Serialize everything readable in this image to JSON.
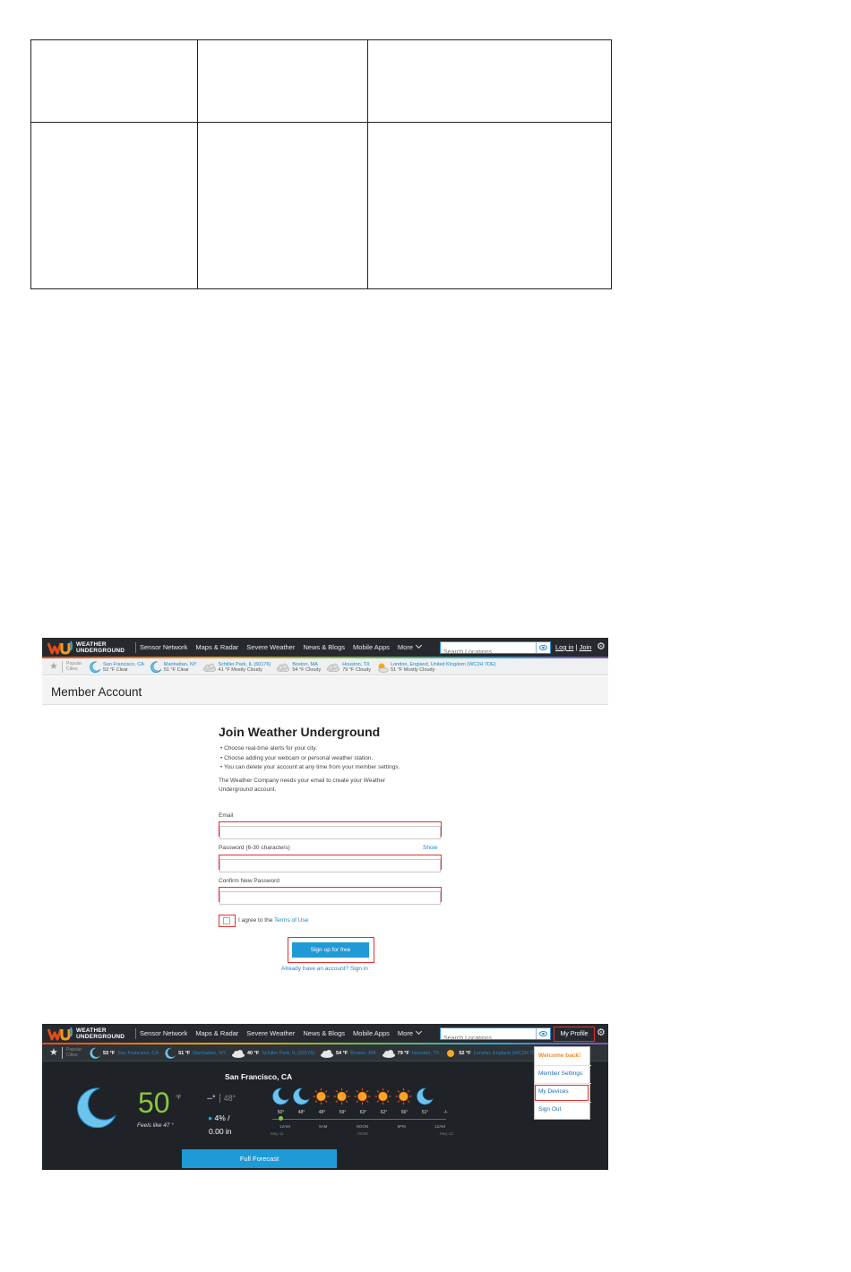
{
  "nav": {
    "logo_line1": "WEATHER",
    "logo_line2": "UNDERGROUND",
    "items": [
      "Sensor Network",
      "Maps & Radar",
      "Severe Weather",
      "News & Blogs",
      "Mobile Apps",
      "More"
    ],
    "search_placeholder": "Search Locations",
    "login": "Log in",
    "divider": "|",
    "join": "Join",
    "my_profile": "My Profile"
  },
  "popular": {
    "label_line1": "Popular",
    "label_line2": "Cities",
    "cities_light": [
      {
        "name": "San Francisco, CA",
        "cond": "53 °F Clear"
      },
      {
        "name": "Manhattan, NY",
        "cond": "51 °F Clear"
      },
      {
        "name": "Schiller Park, IL (60176)",
        "cond": "41 °F Mostly Cloudy"
      },
      {
        "name": "Boston, MA",
        "cond": "54 °F Cloudy"
      },
      {
        "name": "Houston, TX",
        "cond": "79 °F Cloudy"
      },
      {
        "name": "London, England, United Kingdom (WC2H 7DE)",
        "cond": "51 °F Mostly Cloudy"
      }
    ],
    "cities_dark": [
      {
        "temp": "53 °F",
        "name": "San Francisco, CA"
      },
      {
        "temp": "51 °F",
        "name": "Manhattan, NY"
      },
      {
        "temp": "40 °F",
        "name": "Schiller Park, IL (60176)"
      },
      {
        "temp": "54 °F",
        "name": "Boston, MA"
      },
      {
        "temp": "79 °F",
        "name": "Houston, TX"
      },
      {
        "temp": "52 °F",
        "name": "London, England (WC2H 7DE)"
      }
    ]
  },
  "member": {
    "title": "Member Account",
    "form_title": "Join Weather Underground",
    "bullets": [
      "Choose real-time alerts for your city.",
      "Choose adding your webcam or personal weather station.",
      "You can delete your account at any time from your member settings."
    ],
    "note": "The Weather Company needs your email to create your Weather Underground account.",
    "email_label": "Email",
    "password_label": "Password (6-30 characters)",
    "show": "Show",
    "confirm_label": "Confirm New Password",
    "agree_prefix": "I agree to the",
    "terms": "Terms of Use",
    "signup": "Sign up for free",
    "already": "Already have an account? Sign in"
  },
  "dropdown": {
    "welcome": "Welcome back!",
    "settings": "Member Settings",
    "devices": "My Devices",
    "signout": "Sign Out"
  },
  "weather": {
    "location": "San Francisco, CA",
    "temp": "50",
    "unit": "°F",
    "feels": "Feels like 47 °",
    "high": "--°",
    "low": "48°",
    "precip": "4% /",
    "rain": "0.00 in",
    "hourly_temps": [
      "50°",
      "48°",
      "48°",
      "59°",
      "63°",
      "62°",
      "56°",
      "51°",
      "-/-"
    ],
    "timeline_labels": [
      "12AM",
      "6AM",
      "NOON",
      "6PM",
      "12AM"
    ],
    "start_date": "May 11",
    "end_date": "May 12",
    "noon_sub": "+5025",
    "full_forecast": "Full Forecast"
  },
  "colors": {
    "accent_blue": "#1f9ad6",
    "highlight_red": "#e03131",
    "temp_green": "#8cc63f",
    "nav_dark": "#262a2e"
  }
}
